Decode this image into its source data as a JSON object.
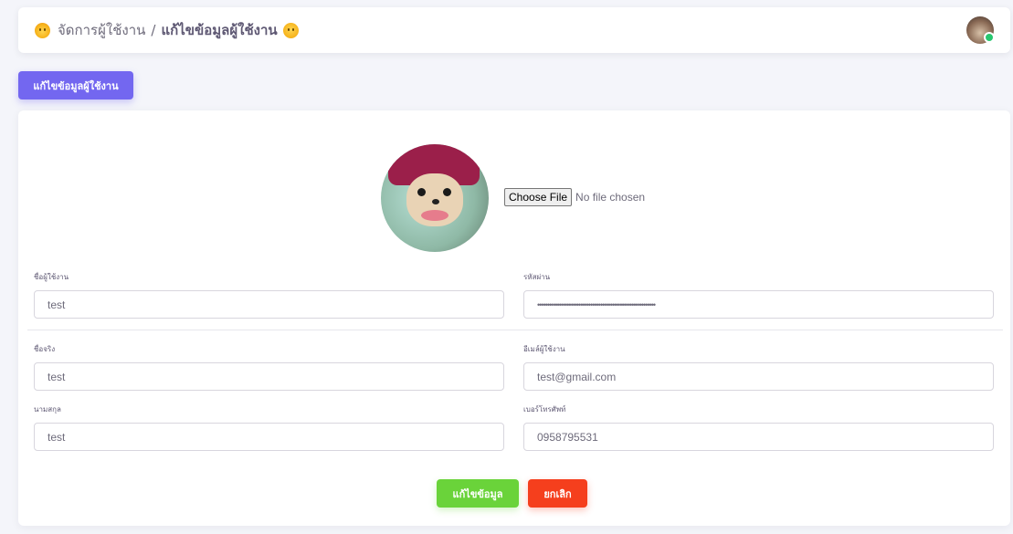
{
  "navbar": {
    "breadcrumb_root": "จัดการผู้ใช้งาน",
    "breadcrumb_sep": "/",
    "breadcrumb_current": "แก้ไขข้อมูลผู้ใช้งาน"
  },
  "page_button": "แก้ไขข้อมูลผู้ใช้งาน",
  "file_input": {
    "button": "Choose File",
    "status": "No file chosen"
  },
  "form": {
    "username": {
      "label": "ชื่อผู้ใช้งาน",
      "value": "test"
    },
    "password": {
      "label": "รหัสผ่าน",
      "value": "••••••••••••••••••••••••••••••••••••••••••••••••••••••••••••"
    },
    "first_name": {
      "label": "ชื่อจริง",
      "value": "test"
    },
    "email": {
      "label": "อีเมล์ผู้ใช้งาน",
      "value": "test@gmail.com"
    },
    "last_name": {
      "label": "นามสกุล",
      "value": "test"
    },
    "phone": {
      "label": "เบอร์โทรศัพท์",
      "value": "0958795531"
    }
  },
  "actions": {
    "save": "แก้ไขข้อมูล",
    "cancel": "ยกเลิก"
  },
  "colors": {
    "primary": "#7367f0",
    "success": "#6ad33a",
    "danger": "#f53f1d",
    "background": "#f4f5fa"
  },
  "icons": {
    "left": "grinning-face-icon",
    "right": "smiling-face-icon"
  }
}
